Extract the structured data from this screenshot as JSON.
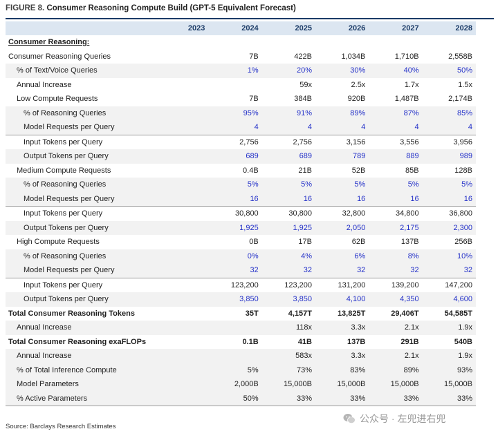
{
  "figure": {
    "label": "FIGURE 8.",
    "title": "Consumer Reasoning Compute Build (GPT-5 Equivalent Forecast)"
  },
  "columns": [
    "",
    "2023",
    "2024",
    "2025",
    "2026",
    "2027",
    "2028"
  ],
  "rows": [
    {
      "label": "Consumer Reasoning:",
      "level": 0,
      "style": "section",
      "shade": false,
      "values": [
        "",
        "",
        "",
        "",
        "",
        ""
      ]
    },
    {
      "label": "Consumer Reasoning Queries",
      "level": 0,
      "style": "normal",
      "shade": false,
      "values": [
        "",
        "7B",
        "422B",
        "1,034B",
        "1,710B",
        "2,558B"
      ]
    },
    {
      "label": "% of Text/Voice Queries",
      "level": 1,
      "style": "blue",
      "shade": true,
      "values": [
        "",
        "1%",
        "20%",
        "30%",
        "40%",
        "50%"
      ]
    },
    {
      "label": "Annual Increase",
      "level": 1,
      "style": "normal",
      "shade": false,
      "values": [
        "",
        "",
        "59x",
        "2.5x",
        "1.7x",
        "1.5x"
      ]
    },
    {
      "label": "Low Compute Requests",
      "level": 1,
      "style": "normal",
      "shade": false,
      "values": [
        "",
        "7B",
        "384B",
        "920B",
        "1,487B",
        "2,174B"
      ]
    },
    {
      "label": "% of Reasoning Queries",
      "level": 2,
      "style": "blue",
      "shade": true,
      "values": [
        "",
        "95%",
        "91%",
        "89%",
        "87%",
        "85%"
      ]
    },
    {
      "label": "Model Requests per Query",
      "level": 2,
      "style": "blue",
      "shade": true,
      "values": [
        "",
        "4",
        "4",
        "4",
        "4",
        "4"
      ]
    },
    {
      "label": "Input Tokens per Query",
      "level": 2,
      "style": "normal",
      "shade": false,
      "divider": true,
      "values": [
        "",
        "2,756",
        "2,756",
        "3,156",
        "3,556",
        "3,956"
      ]
    },
    {
      "label": "Output Tokens per Query",
      "level": 2,
      "style": "blue",
      "shade": true,
      "values": [
        "",
        "689",
        "689",
        "789",
        "889",
        "989"
      ]
    },
    {
      "label": "Medium Compute Requests",
      "level": 1,
      "style": "normal",
      "shade": false,
      "values": [
        "",
        "0.4B",
        "21B",
        "52B",
        "85B",
        "128B"
      ]
    },
    {
      "label": "% of Reasoning Queries",
      "level": 2,
      "style": "blue",
      "shade": true,
      "values": [
        "",
        "5%",
        "5%",
        "5%",
        "5%",
        "5%"
      ]
    },
    {
      "label": "Model Requests per Query",
      "level": 2,
      "style": "blue",
      "shade": true,
      "values": [
        "",
        "16",
        "16",
        "16",
        "16",
        "16"
      ]
    },
    {
      "label": "Input Tokens per Query",
      "level": 2,
      "style": "normal",
      "shade": false,
      "divider": true,
      "values": [
        "",
        "30,800",
        "30,800",
        "32,800",
        "34,800",
        "36,800"
      ]
    },
    {
      "label": "Output Tokens per Query",
      "level": 2,
      "style": "blue",
      "shade": true,
      "values": [
        "",
        "1,925",
        "1,925",
        "2,050",
        "2,175",
        "2,300"
      ]
    },
    {
      "label": "High Compute Requests",
      "level": 1,
      "style": "normal",
      "shade": false,
      "values": [
        "",
        "0B",
        "17B",
        "62B",
        "137B",
        "256B"
      ]
    },
    {
      "label": "% of Reasoning Queries",
      "level": 2,
      "style": "blue",
      "shade": true,
      "values": [
        "",
        "0%",
        "4%",
        "6%",
        "8%",
        "10%"
      ]
    },
    {
      "label": "Model Requests per Query",
      "level": 2,
      "style": "blue",
      "shade": true,
      "values": [
        "",
        "32",
        "32",
        "32",
        "32",
        "32"
      ]
    },
    {
      "label": "Input Tokens per Query",
      "level": 2,
      "style": "normal",
      "shade": false,
      "divider": true,
      "values": [
        "",
        "123,200",
        "123,200",
        "131,200",
        "139,200",
        "147,200"
      ]
    },
    {
      "label": "Output Tokens per Query",
      "level": 2,
      "style": "blue",
      "shade": true,
      "values": [
        "",
        "3,850",
        "3,850",
        "4,100",
        "4,350",
        "4,600"
      ]
    },
    {
      "label": "Total Consumer Reasoning Tokens",
      "level": 0,
      "style": "bold",
      "shade": false,
      "values": [
        "",
        "35T",
        "4,157T",
        "13,825T",
        "29,406T",
        "54,585T"
      ]
    },
    {
      "label": "Annual Increase",
      "level": 1,
      "style": "normal",
      "shade": true,
      "values": [
        "",
        "",
        "118x",
        "3.3x",
        "2.1x",
        "1.9x"
      ]
    },
    {
      "label": "Total Consumer Reasoning exaFLOPs",
      "level": 0,
      "style": "bold",
      "shade": false,
      "values": [
        "",
        "0.1B",
        "41B",
        "137B",
        "291B",
        "540B"
      ]
    },
    {
      "label": "Annual Increase",
      "level": 1,
      "style": "normal",
      "shade": true,
      "values": [
        "",
        "",
        "583x",
        "3.3x",
        "2.1x",
        "1.9x"
      ]
    },
    {
      "label": "% of Total Inference Compute",
      "level": 1,
      "style": "normal",
      "shade": true,
      "values": [
        "",
        "5%",
        "73%",
        "83%",
        "89%",
        "93%"
      ]
    },
    {
      "label": "Model Parameters",
      "level": 1,
      "style": "normal",
      "shade": true,
      "values": [
        "",
        "2,000B",
        "15,000B",
        "15,000B",
        "15,000B",
        "15,000B"
      ]
    },
    {
      "label": "% Active Parameters",
      "level": 1,
      "style": "normal",
      "shade": true,
      "last": true,
      "values": [
        "",
        "50%",
        "33%",
        "33%",
        "33%",
        "33%"
      ]
    }
  ],
  "source": "Source: Barclays Research Estimates",
  "watermark": {
    "text": "公众号 · 左兜进右兜",
    "icon": "wechat-icon"
  },
  "colors": {
    "header_fill": "#dce6f1",
    "title_rule": "#1b3b67",
    "input_blue": "#2330c8",
    "shade": "#f2f2f2"
  }
}
